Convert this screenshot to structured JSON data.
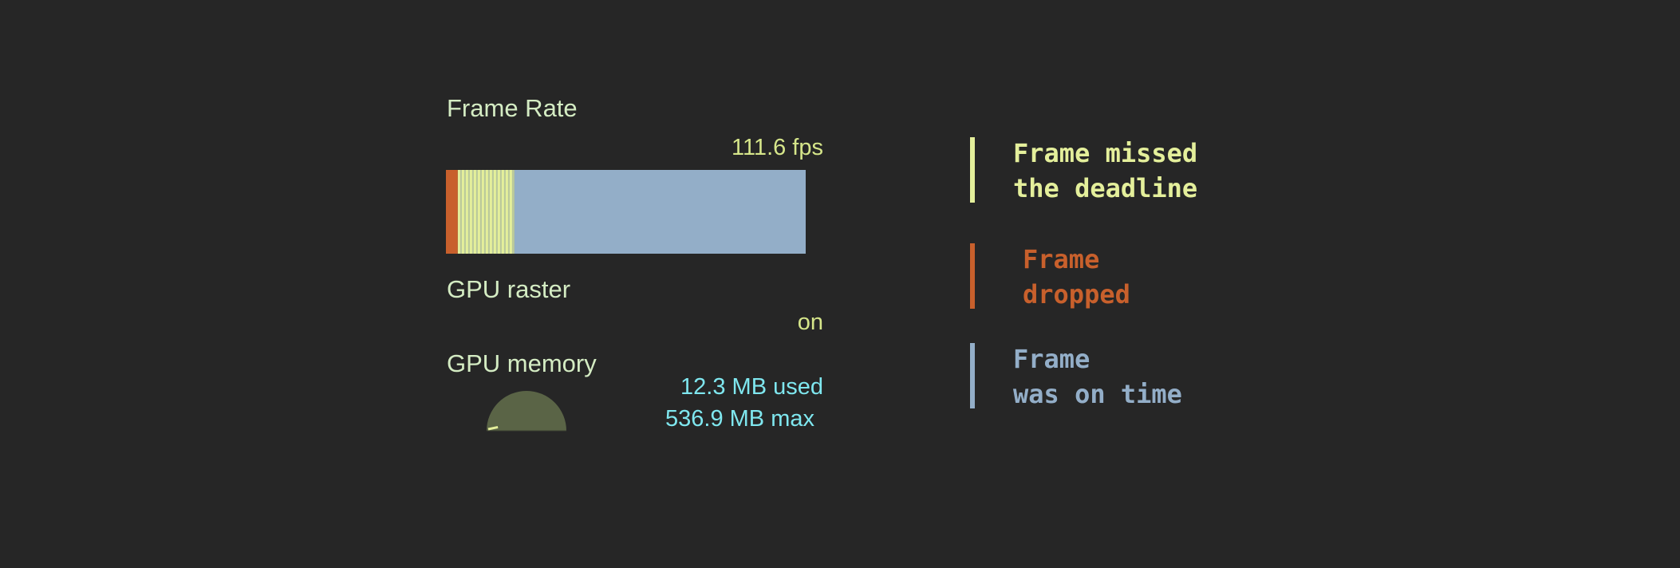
{
  "colors": {
    "background": "#262626",
    "label": "#d4ecc3",
    "fps_value": "#d6e68a",
    "missed": "#e4ef9b",
    "dropped": "#c8602c",
    "on_time": "#93aec8",
    "gpu_raster_value": "#d6e68a",
    "gpu_memory_value": "#7fe7ef",
    "gauge_fill": "#5a6446",
    "gauge_needle": "#e4ef9b"
  },
  "frame_rate": {
    "title": "Frame Rate",
    "value_text": "111.6 fps",
    "history": {
      "dropped_fraction": 0.033,
      "missed_fraction": 0.157,
      "on_time_fraction": 0.81,
      "missed_pattern": "striped"
    }
  },
  "gpu_raster": {
    "title": "GPU raster",
    "value": "on"
  },
  "gpu_memory": {
    "title": "GPU memory",
    "used": "12.3 MB used",
    "max": "536.9 MB max",
    "gauge": {
      "used_mb": 12.3,
      "max_mb": 536.9
    }
  },
  "legend": {
    "missed": {
      "line1": "Frame missed",
      "line2": "the deadline",
      "icon": "legend-bar-missed"
    },
    "dropped": {
      "line1": "Frame",
      "line2": "dropped",
      "icon": "legend-bar-dropped"
    },
    "on_time": {
      "line1": "Frame",
      "line2": "was on time",
      "icon": "legend-bar-on-time"
    }
  }
}
